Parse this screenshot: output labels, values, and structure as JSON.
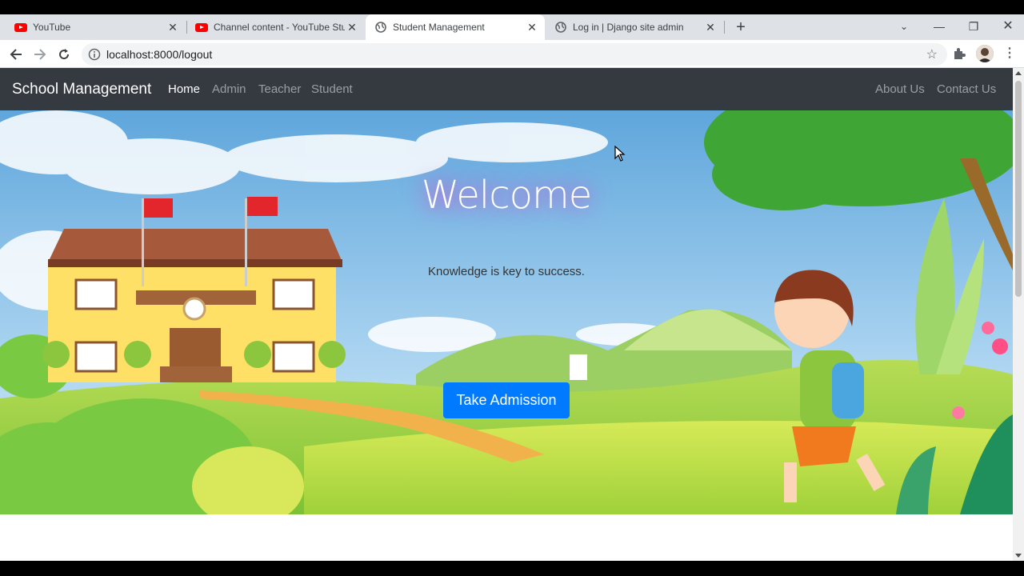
{
  "browser": {
    "tabs": [
      {
        "title": "YouTube",
        "favicon": "youtube-icon",
        "active": false
      },
      {
        "title": "Channel content - YouTube Studi",
        "favicon": "youtube-icon",
        "active": false
      },
      {
        "title": "Student Management",
        "favicon": "globe-icon",
        "active": true
      },
      {
        "title": "Log in | Django site admin",
        "favicon": "globe-icon",
        "active": false
      }
    ],
    "url": "localhost:8000/logout"
  },
  "site": {
    "brand": "School Management",
    "nav_left": [
      "Home",
      "Admin",
      "Teacher",
      "Student"
    ],
    "nav_right": [
      "About Us",
      "Contact Us"
    ],
    "active_nav": "Home"
  },
  "hero": {
    "heading": "Welcome",
    "tagline": "Knowledge is key to success.",
    "cta_label": "Take Admission"
  },
  "colors": {
    "navbar_bg": "#343a40",
    "cta_bg": "#007bff",
    "sky": "#7fb8e6",
    "grass": "#8cc63f"
  }
}
